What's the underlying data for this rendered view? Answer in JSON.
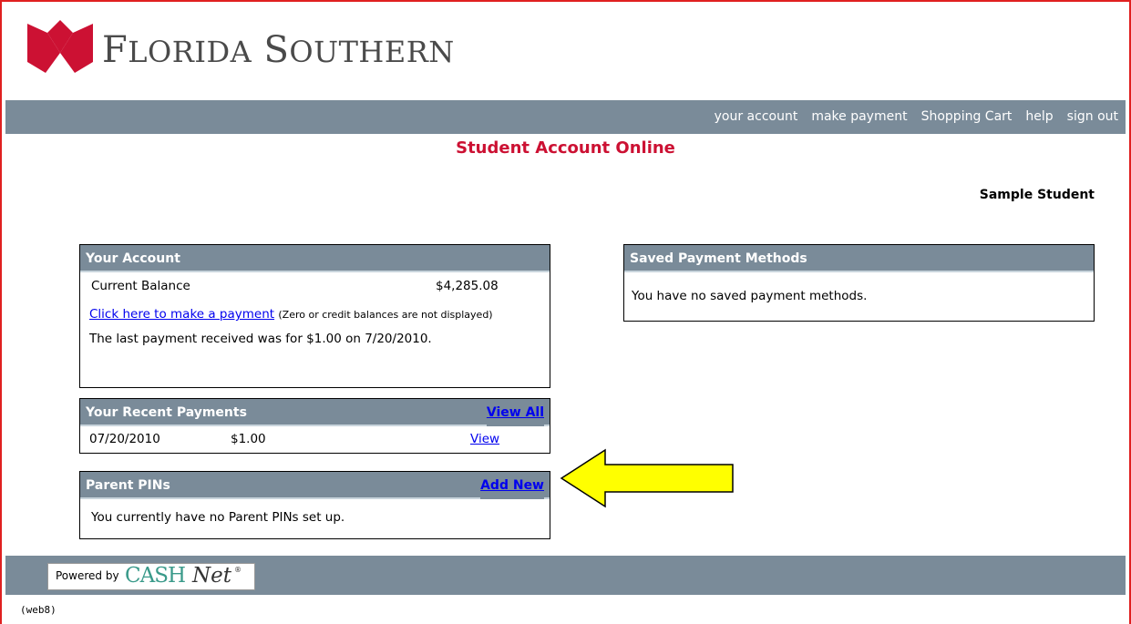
{
  "brand": {
    "name_first_initial": "F",
    "name_first_rest": "LORIDA",
    "name_second_initial": "S",
    "name_second_rest": "OUTHERN",
    "accent_color": "#cc1133"
  },
  "topnav": {
    "items": [
      "your account",
      "make payment",
      "Shopping Cart",
      "help",
      "sign out"
    ]
  },
  "page": {
    "title": "Student Account Online",
    "user_name": "Sample Student"
  },
  "your_account": {
    "header": "Your Account",
    "balance_label": "Current Balance",
    "balance_value": "$4,285.08",
    "payment_link": "Click here to make a payment",
    "payment_note": "(Zero or credit balances are not displayed)",
    "last_payment": "The last payment received was for $1.00 on 7/20/2010."
  },
  "recent_payments": {
    "header": "Your Recent Payments",
    "view_all": "View All",
    "rows": [
      {
        "date": "07/20/2010",
        "amount": "$1.00",
        "action": "View"
      }
    ]
  },
  "parent_pins": {
    "header": "Parent PINs",
    "add_new": "Add New",
    "empty_text": "You currently have no Parent PINs set up."
  },
  "saved_methods": {
    "header": "Saved Payment Methods",
    "empty_text": "You have no saved payment methods."
  },
  "footer": {
    "powered_by": "Powered by",
    "cash": "CASH",
    "net": "Net",
    "registered": "®",
    "server_tag": "(web8)"
  },
  "annotation": {
    "arrow_color": "#ffff00"
  }
}
